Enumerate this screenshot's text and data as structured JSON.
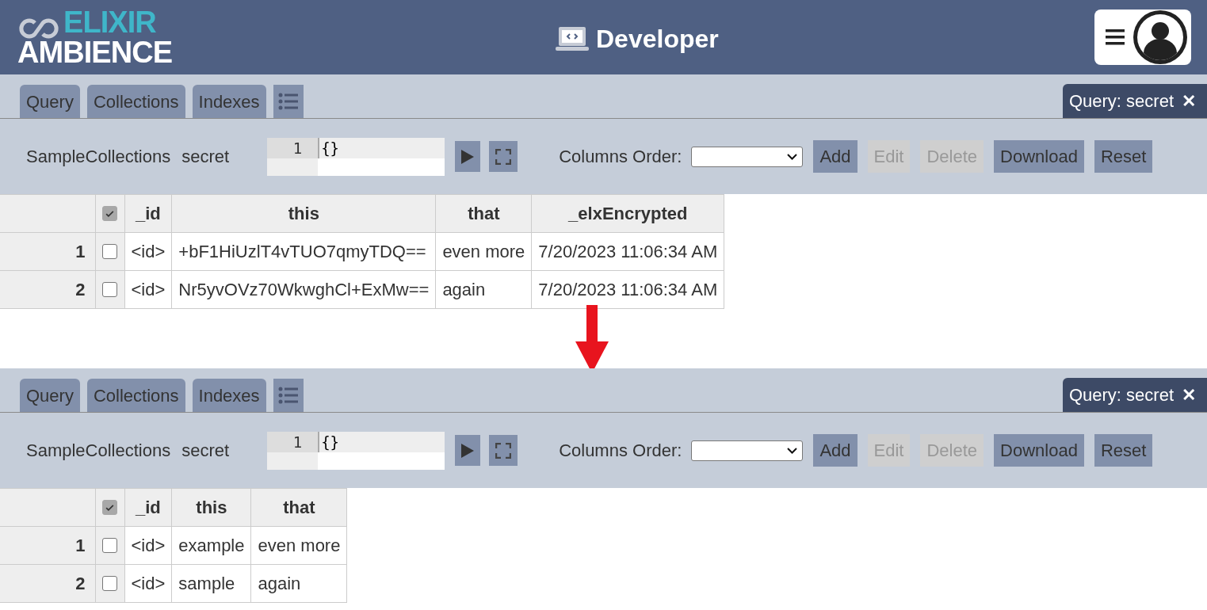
{
  "header": {
    "logo_top": "ELIXIR",
    "logo_bottom": "AMBIENCE",
    "title": "Developer"
  },
  "panels": [
    {
      "tabs": [
        {
          "label": "Query",
          "selected": false
        },
        {
          "label": "Collections",
          "selected": false
        },
        {
          "label": "Indexes",
          "selected": false
        }
      ],
      "open_tabs": [
        {
          "label": "Query: secret",
          "selected": true,
          "close": "✕"
        }
      ],
      "toolbar": {
        "collection": "SampleCollections",
        "name": "secret",
        "editor": {
          "line": "1",
          "value": "{}"
        },
        "columns_order_label": "Columns Order:",
        "buttons": [
          {
            "label": "Add",
            "disabled": false
          },
          {
            "label": "Edit",
            "disabled": true
          },
          {
            "label": "Delete",
            "disabled": true
          },
          {
            "label": "Download",
            "disabled": false
          },
          {
            "label": "Reset",
            "disabled": false
          }
        ]
      },
      "table": {
        "select_all_checked": true,
        "columns": [
          "_id",
          "this",
          "that",
          "_elxEncrypted"
        ],
        "rows": [
          {
            "index": "1",
            "checked": false,
            "cells": [
              "<id>",
              "+bF1HiUzlT4vTUO7qmyTDQ==",
              "even more",
              "7/20/2023 11:06:34 AM"
            ]
          },
          {
            "index": "2",
            "checked": false,
            "cells": [
              "<id>",
              "Nr5yvOVz70WkwghCl+ExMw==",
              "again",
              "7/20/2023 11:06:34 AM"
            ]
          }
        ]
      }
    },
    {
      "tabs": [
        {
          "label": "Query",
          "selected": false
        },
        {
          "label": "Collections",
          "selected": false
        },
        {
          "label": "Indexes",
          "selected": false
        }
      ],
      "open_tabs": [
        {
          "label": "Query: secret",
          "selected": true,
          "close": "✕"
        }
      ],
      "toolbar": {
        "collection": "SampleCollections",
        "name": "secret",
        "editor": {
          "line": "1",
          "value": "{}"
        },
        "columns_order_label": "Columns Order:",
        "buttons": [
          {
            "label": "Add",
            "disabled": false
          },
          {
            "label": "Edit",
            "disabled": true
          },
          {
            "label": "Delete",
            "disabled": true
          },
          {
            "label": "Download",
            "disabled": false
          },
          {
            "label": "Reset",
            "disabled": false
          }
        ]
      },
      "table": {
        "select_all_checked": true,
        "columns": [
          "_id",
          "this",
          "that"
        ],
        "rows": [
          {
            "index": "1",
            "checked": false,
            "cells": [
              "<id>",
              "example",
              "even more"
            ]
          },
          {
            "index": "2",
            "checked": false,
            "cells": [
              "<id>",
              "sample",
              "again"
            ]
          }
        ]
      }
    }
  ]
}
